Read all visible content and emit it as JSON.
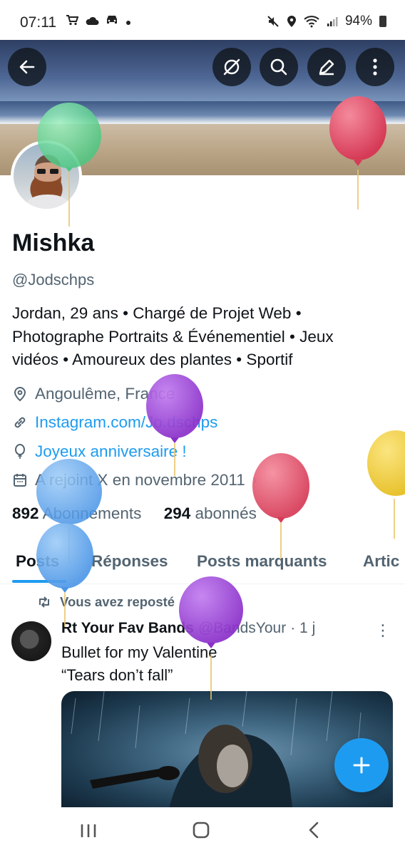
{
  "status_bar": {
    "time": "07:11",
    "left_icons": [
      "cart-icon",
      "cloud-icon",
      "car-icon",
      "dot-icon"
    ],
    "right_icons": [
      "mute-icon",
      "location-icon",
      "wifi-icon",
      "signal-icon"
    ],
    "battery": "94%"
  },
  "toolbar": {
    "back_icon": "back-arrow-icon",
    "actions": [
      "grok-icon",
      "search-icon",
      "edit-icon",
      "more-icon"
    ]
  },
  "profile": {
    "name": "Mishka",
    "handle": "@Jodschps",
    "bio_lines": [
      "Jordan, 29 ans • Chargé de Projet Web •",
      "Photographe Portraits & Événementiel • Jeux",
      "vidéos • Amoureux des plantes • Sportif"
    ],
    "location": "Angoulême, France",
    "website": "Instagram.com/Jo.dschps",
    "birthday": "Joyeux anniversaire !",
    "joined": "A rejoint X en novembre 2011",
    "following_count": "892",
    "following_label": "Abonnements",
    "followers_count": "294",
    "followers_label": "abonnés"
  },
  "tabs": [
    "Posts",
    "Réponses",
    "Posts marquants",
    "Artic"
  ],
  "post": {
    "repost_label": "Vous avez reposté",
    "author": "Rt Your Fav Bands",
    "author_handle": "@BandsYour",
    "time": "· 1 j",
    "lines": [
      "Bullet for my Valentine",
      "“Tears don’t fall”"
    ]
  },
  "fab_icon": "plus-icon",
  "navbar": [
    "recents-icon",
    "home-icon",
    "back-icon"
  ],
  "colors": {
    "accent": "#1d9bf0",
    "balloon_green": "#6fd89a",
    "balloon_red": "#e8566e",
    "balloon_purple": "#9b3fd6",
    "balloon_blue": "#63a8ee",
    "balloon_yellow": "#f2d34a"
  }
}
